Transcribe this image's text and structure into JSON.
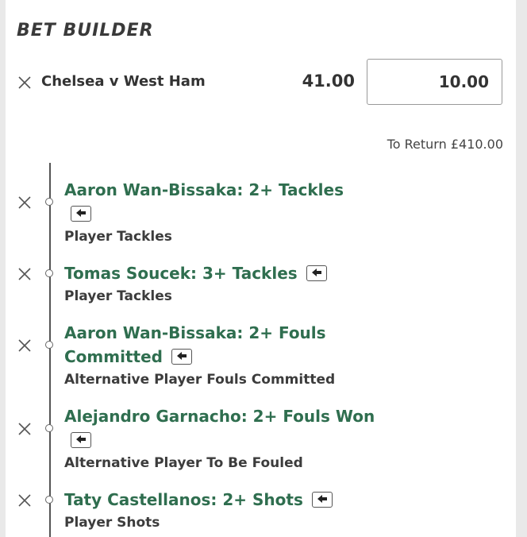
{
  "header": {
    "title": "BET BUILDER"
  },
  "bet": {
    "event": "Chelsea v West Ham",
    "odds": "41.00",
    "stake": "10.00",
    "to_return": "To Return £410.00"
  },
  "legs": [
    {
      "selection": "Aaron Wan-Bissaka: 2+ Tackles",
      "market": "Player Tackles"
    },
    {
      "selection": "Tomas Soucek: 3+ Tackles",
      "market": "Player Tackles"
    },
    {
      "selection_line1": "Aaron Wan-Bissaka: 2+ Fouls",
      "selection_line2": "Committed",
      "market": "Alternative Player Fouls Committed"
    },
    {
      "selection": "Alejandro Garnacho: 2+ Fouls Won",
      "market": "Alternative Player To Be Fouled"
    },
    {
      "selection": "Taty Castellanos: 2+ Shots",
      "market": "Player Shots"
    }
  ],
  "icons": {
    "remove": "close-icon",
    "swap": "swap-icon"
  },
  "colors": {
    "selection": "#2f6e4f",
    "text": "#333333"
  }
}
